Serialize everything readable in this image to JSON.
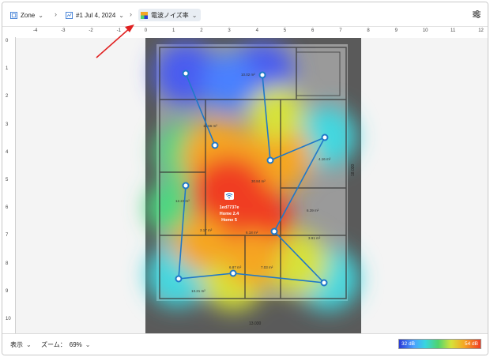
{
  "breadcrumb": {
    "zone_label": "Zone",
    "survey_label": "#1 Jul 4, 2024",
    "layer_label": "電波ノイズ率"
  },
  "icons": {
    "zone": "zone-icon",
    "survey": "survey-icon",
    "layer": "heatmap-layer-icon",
    "settings": "sliders-icon",
    "ap": "wifi-icon"
  },
  "ruler": {
    "x_ticks": [
      "-4",
      "-3",
      "-2",
      "-1",
      "0",
      "1",
      "2",
      "3",
      "4",
      "5",
      "6",
      "7",
      "8",
      "9",
      "10",
      "11",
      "12"
    ],
    "y_ticks": [
      "0",
      "1",
      "2",
      "3",
      "4",
      "5",
      "6",
      "7",
      "8",
      "9",
      "10"
    ]
  },
  "floorplan": {
    "rooms": [
      "10.02 m²",
      "",
      "14.66 m²",
      "30.84 m²",
      "12.23 m²",
      "6.39 m²",
      "3.17 m²",
      "6.18 m²",
      "3.91 m²",
      "6.87 m²",
      "7.03 m²",
      "13.21 m²",
      "4.16 m²"
    ],
    "dims": [
      "13.030",
      "18.030"
    ]
  },
  "access_point": {
    "name": "1ed7737e",
    "ssid_1": "Home 2.4",
    "ssid_2": "Home 5"
  },
  "bottom": {
    "view_label": "表示",
    "zoom_label": "ズーム：",
    "zoom_value": "69%"
  },
  "legend": {
    "min_label": "32 dB",
    "max_label": "54 dB"
  },
  "colors": {
    "accent": "#1f78c8",
    "arrow": "#e02020",
    "active_crumb_bg": "#e8edf3"
  }
}
